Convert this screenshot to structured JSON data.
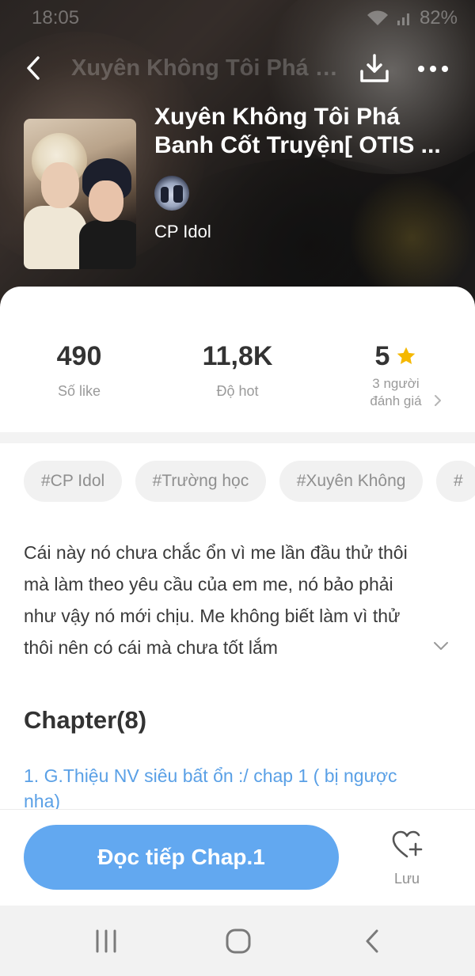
{
  "status_bar": {
    "time": "18:05",
    "battery": "82%"
  },
  "app_bar": {
    "title": "Xuyên Không Tôi Phá Banh Cốt Truyện[ OTIS ..."
  },
  "book": {
    "title": "Xuyên Không Tôi Phá Banh Cốt Truyện[ OTIS ...",
    "author": "CP Idol"
  },
  "stats": {
    "likes_value": "490",
    "likes_label": "Số like",
    "hot_value": "11,8K",
    "hot_label": "Độ hot",
    "rating_value": "5",
    "rating_label_line1": "3 người",
    "rating_label_line2": "đánh giá"
  },
  "tags": [
    "#CP Idol",
    "#Trường học",
    "#Xuyên Không",
    "#"
  ],
  "description": "Cái này nó chưa chắc ổn vì me lần đầu thử thôi mà làm theo yêu cầu của em me, nó bảo phải như vậy nó mới chịu. Me không biết làm vì thử thôi nên có cái mà chưa tốt lắm",
  "chapters": {
    "heading": "Chapter(8)",
    "first": "1. G.Thiệu NV siêu bất ổn :/ chap 1 ( bị ngược nha)"
  },
  "actions": {
    "read_label": "Đọc tiếp Chap.1",
    "save_label": "Lưu"
  },
  "colors": {
    "accent": "#62a8f0",
    "link": "#5aa0e6",
    "star": "#f5b800"
  },
  "icons": [
    "back-arrow-icon",
    "download-icon",
    "more-icon",
    "star-icon",
    "chevron-right-icon",
    "chevron-down-icon",
    "heart-plus-icon",
    "recent-apps-icon",
    "home-icon",
    "nav-back-icon",
    "wifi-icon",
    "signal-icon"
  ]
}
